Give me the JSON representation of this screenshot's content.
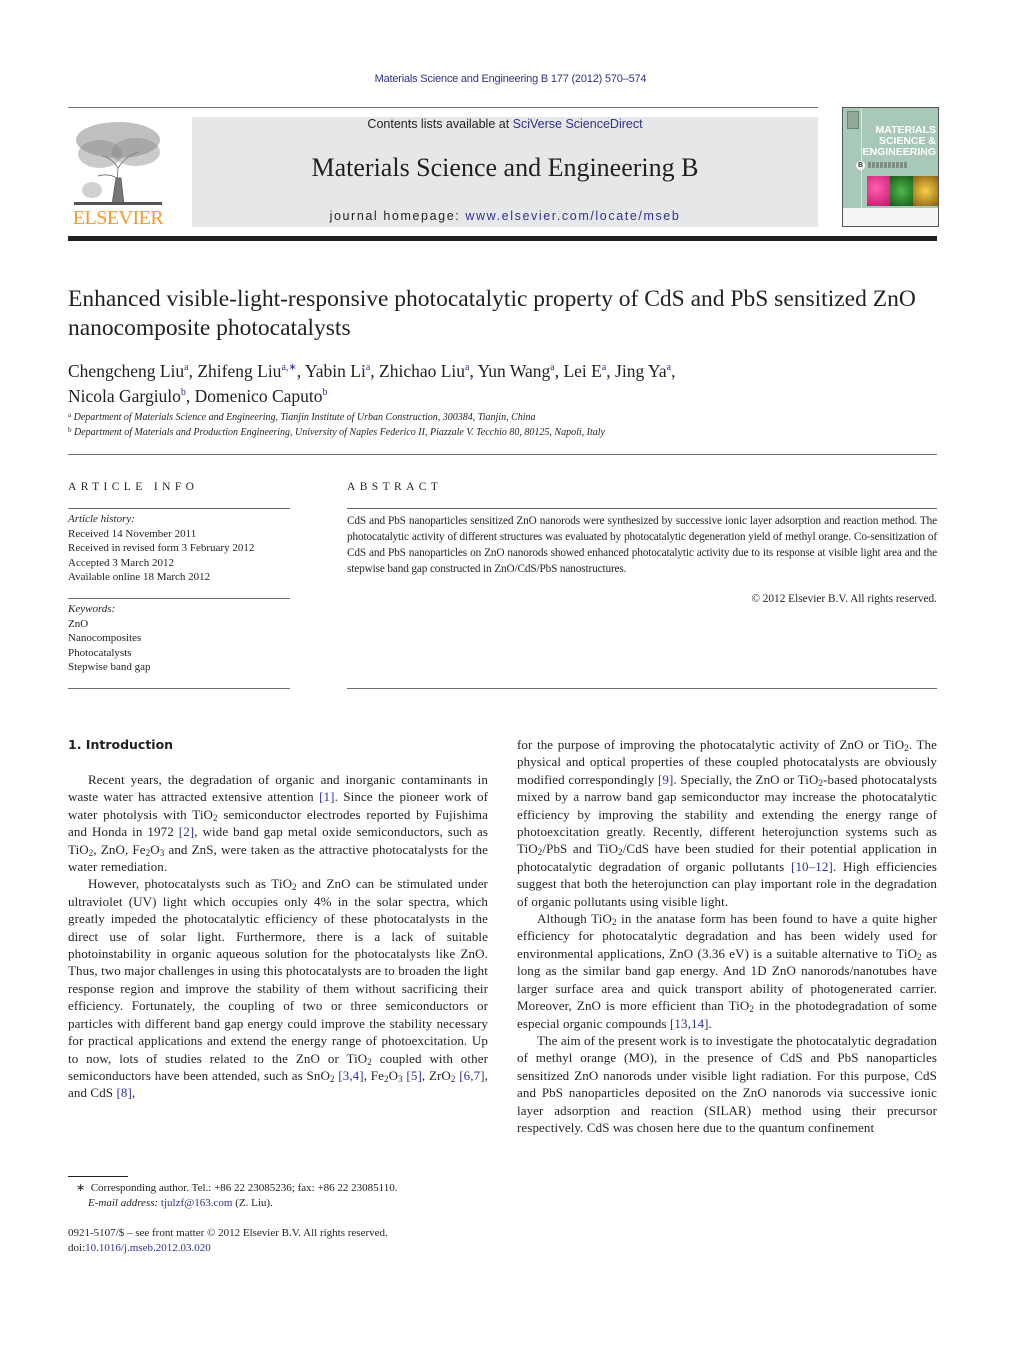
{
  "header": {
    "running_head": "Materials Science and Engineering B 177 (2012) 570–574",
    "publisher_logo_text": "ELSEVIER",
    "contents_prefix": "Contents lists available at ",
    "contents_link": "SciVerse ScienceDirect",
    "journal_title": "Materials Science and Engineering B",
    "homepage_prefix": "journal homepage: ",
    "homepage_link": "www.elsevier.com/locate/mseb",
    "cover_title": "MATERIALS SCIENCE & ENGINEERING",
    "cover_badge": "B"
  },
  "article": {
    "title": "Enhanced visible-light-responsive photocatalytic property of CdS and PbS sensitized ZnO nanocomposite photocatalysts",
    "authors": [
      {
        "name": "Chengcheng Liu",
        "aff": "a"
      },
      {
        "name": "Zhifeng Liu",
        "aff": "a,∗"
      },
      {
        "name": "Yabin Li",
        "aff": "a"
      },
      {
        "name": "Zhichao Liu",
        "aff": "a"
      },
      {
        "name": "Yun Wang",
        "aff": "a"
      },
      {
        "name": "Lei E",
        "aff": "a"
      },
      {
        "name": "Jing Ya",
        "aff": "a"
      },
      {
        "name": "Nicola Gargiulo",
        "aff": "b"
      },
      {
        "name": "Domenico Caputo",
        "aff": "b"
      }
    ],
    "affiliations": [
      {
        "mark": "a",
        "text": "Department of Materials Science and Engineering, Tianjin Institute of Urban Construction, 300384, Tianjin, China"
      },
      {
        "mark": "b",
        "text": "Department of Materials and Production Engineering, University of Naples Federico II, Piazzale V. Tecchio 80, 80125, Napoli, Italy"
      }
    ]
  },
  "article_info": {
    "heading": "ARTICLE INFO",
    "history_label": "Article history:",
    "history": [
      "Received 14 November 2011",
      "Received in revised form 3 February 2012",
      "Accepted 3 March 2012",
      "Available online 18 March 2012"
    ],
    "keywords_label": "Keywords:",
    "keywords": [
      "ZnO",
      "Nanocomposites",
      "Photocatalysts",
      "Stepwise band gap"
    ]
  },
  "abstract": {
    "heading": "ABSTRACT",
    "text": "CdS and PbS nanoparticles sensitized ZnO nanorods were synthesized by successive ionic layer adsorption and reaction method. The photocatalytic activity of different structures was evaluated by photocatalytic degeneration yield of methyl orange. Co-sensitization of CdS and PbS nanoparticles on ZnO nanorods showed enhanced photocatalytic activity due to its response at visible light area and the stepwise band gap constructed in ZnO/CdS/PbS nanostructures.",
    "copyright": "© 2012 Elsevier B.V. All rights reserved."
  },
  "introduction": {
    "heading": "1.  Introduction",
    "p1": {
      "t1": "Recent years, the degradation of organic and inorganic contaminants in waste water has attracted extensive attention ",
      "r1": "[1]",
      "t2": ". Since the pioneer work of water photolysis with TiO",
      "t3": " semiconductor electrodes reported by Fujishima and Honda in 1972 ",
      "r2": "[2]",
      "t4": ", wide band gap metal oxide semiconductors, such as TiO",
      "t5": ", ZnO, Fe",
      "t6": "O",
      "t7": " and ZnS, were taken as the attractive photocatalysts for the water remediation."
    },
    "p2": {
      "t1": "However, photocatalysts such as TiO",
      "t2": " and ZnO can be stimulated under ultraviolet (UV) light which occupies only 4% in the solar spectra, which greatly impeded the photocatalytic efficiency of these photocatalysts in the direct use of solar light. Furthermore, there is a lack of suitable photoinstability in organic aqueous solution for the photocatalysts like ZnO. Thus, two major challenges in using this photocatalysts are to broaden the light response region and improve the stability of them without sacrificing their efficiency. Fortunately, the coupling of two or three semiconductors or particles with different band gap energy could improve the stability necessary for practical applications and extend the energy range of photoexcitation. Up to now, lots of studies related to the ZnO or TiO",
      "t3": " coupled with other semiconductors have been attended, such as SnO",
      "r1": "[3,4]",
      "t4": ", Fe",
      "t5": "O",
      "r2": "[5]",
      "t6": ", ZrO",
      "r3": "[6,7]",
      "t7": ", and CdS ",
      "r4": "[8]",
      "t8": ","
    },
    "p3": {
      "t1": "for the purpose of improving the photocatalytic activity of ZnO or TiO",
      "t2": ". The physical and optical properties of these coupled photocatalysts are obviously modified correspondingly ",
      "r1": "[9]",
      "t3": ". Specially, the ZnO or TiO",
      "t4": "-based photocatalysts mixed by a narrow band gap semiconductor may increase the photocatalytic efficiency by improving the stability and extending the energy range of photoexcitation greatly. Recently, different heterojunction systems such as TiO",
      "t5": "/PbS and TiO",
      "t6": "/CdS have been studied for their potential application in photocatalytic degradation of organic pollutants ",
      "r2": "[10–12]",
      "t7": ". High efficiencies suggest that both the heterojunction can play important role in the degradation of organic pollutants using visible light."
    },
    "p4": {
      "t1": "Although TiO",
      "t2": " in the anatase form has been found to have a quite higher efficiency for photocatalytic degradation and has been widely used for environmental applications, ZnO (3.36 eV) is a suitable alternative to TiO",
      "t3": " as long as the similar band gap energy. And 1D ZnO nanorods/nanotubes have larger surface area and quick transport ability of photogenerated carrier. Moreover, ZnO is more efficient than TiO",
      "t4": " in the photodegradation of some especial organic compounds ",
      "r1": "[13,14]",
      "t5": "."
    },
    "p5": {
      "text": "The aim of the present work is to investigate the photocatalytic degradation of methyl orange (MO), in the presence of CdS and PbS nanoparticles sensitized ZnO nanorods under visible light radiation. For this purpose, CdS and PbS nanoparticles deposited on the ZnO nanorods via successive ionic layer adsorption and reaction (SILAR) method using their precursor respectively. CdS was chosen here due to the quantum confinement"
    },
    "sub2": "2",
    "sub3": "3"
  },
  "footnotes": {
    "star": "∗",
    "corresponding": "Corresponding author. Tel.: +86 22 23085236; fax: +86 22 23085110.",
    "email_label": "E-mail address: ",
    "email": "tjulzf@163.com",
    "email_suffix": " (Z. Liu).",
    "issn": "0921-5107/$ – see front matter © 2012 Elsevier B.V. All rights reserved.",
    "doi_prefix": "doi:",
    "doi": "10.1016/j.mseb.2012.03.020"
  },
  "colors": {
    "link": "#2e3192",
    "elsevier_orange": "#f39a2e",
    "banner_gray": "#e6e7e8",
    "text": "#231f20"
  }
}
